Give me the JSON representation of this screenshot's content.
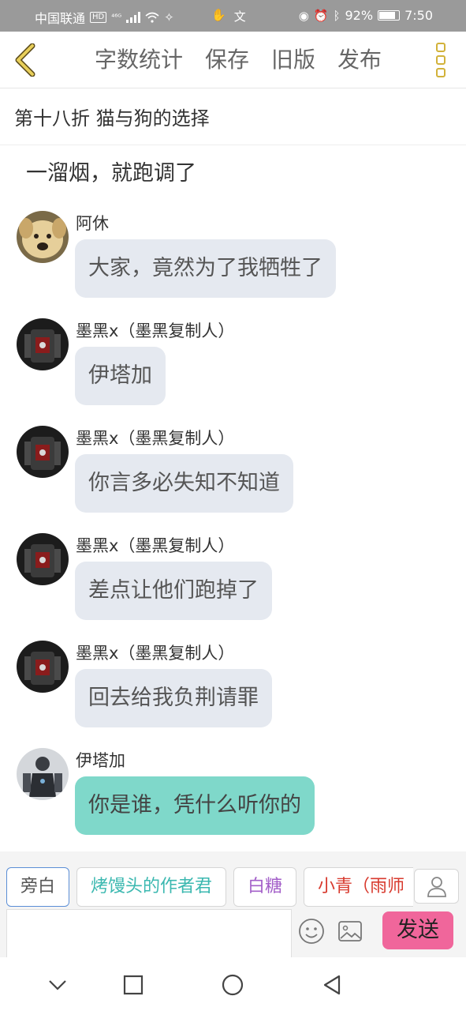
{
  "status_bar": {
    "carrier": "中国联通",
    "hd": "HD",
    "signal": "⁴⁶ᴳ",
    "battery_percent": "92%",
    "battery_level": 0.92,
    "time": "7:50"
  },
  "nav": {
    "word_count": "字数统计",
    "save": "保存",
    "old_version": "旧版",
    "publish": "发布"
  },
  "chapter": {
    "title": "第十八折  猫与狗的选择"
  },
  "chat": {
    "narration": "一溜烟，就跑调了",
    "messages": [
      {
        "sender": "阿休",
        "text": "大家，竟然为了我牺牲了",
        "avatar": "dog-avatar"
      },
      {
        "sender": "墨黑x（墨黑复制人）",
        "text": "伊塔加",
        "avatar": "robot-avatar"
      },
      {
        "sender": "墨黑x（墨黑复制人）",
        "text": "你言多必失知不知道",
        "avatar": "robot-avatar"
      },
      {
        "sender": "墨黑x（墨黑复制人）",
        "text": "差点让他们跑掉了",
        "avatar": "robot-avatar"
      },
      {
        "sender": "墨黑x（墨黑复制人）",
        "text": "回去给我负荆请罪",
        "avatar": "robot-avatar"
      },
      {
        "sender": "伊塔加",
        "text": "你是谁，凭什么听你的",
        "avatar": "armor-avatar"
      }
    ]
  },
  "composer": {
    "roles": [
      {
        "label": "旁白",
        "color": "#555555"
      },
      {
        "label": "烤馒头的作者君",
        "color": "#3bb8b0"
      },
      {
        "label": "白糖",
        "color": "#a35fc9"
      },
      {
        "label": "小青（雨师",
        "color": "#d83a2e"
      }
    ],
    "send": "发送"
  },
  "colors": {
    "accent_gold": "#d2b23a",
    "bubble_other": "#e5e9f0",
    "bubble_self": "#7fd8ca",
    "send_button": "#f0669b"
  }
}
